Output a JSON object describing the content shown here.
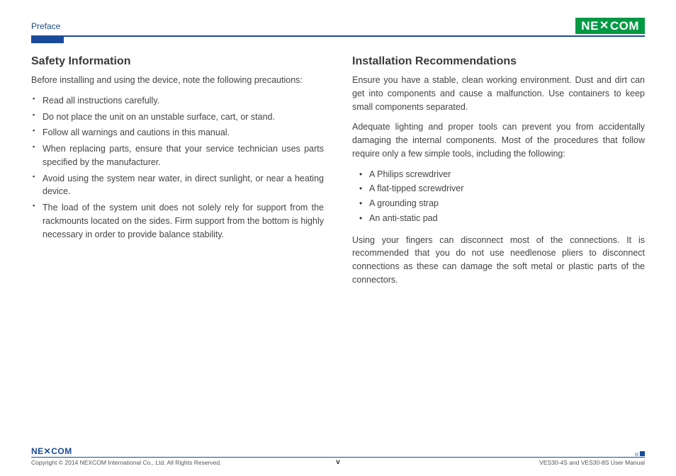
{
  "header": {
    "section": "Preface",
    "logo_text_left": "NE",
    "logo_text_right": "COM"
  },
  "left": {
    "heading": "Safety Information",
    "intro": "Before installing and using the device, note the following precautions:",
    "items": [
      "Read all instructions carefully.",
      "Do not place the unit on an unstable surface, cart, or stand.",
      "Follow all warnings and cautions in this manual.",
      "When replacing parts, ensure that your service technician uses parts specified by the manufacturer.",
      "Avoid using the system near water, in direct sunlight, or near a heating device.",
      "The load of the system unit does not solely rely for support from the rackmounts located on the sides. Firm support from the bottom is highly necessary in order to provide balance stability."
    ]
  },
  "right": {
    "heading": "Installation Recommendations",
    "para1": "Ensure you have a stable, clean working environment. Dust and dirt can get into components and cause a malfunction. Use containers to keep small components separated.",
    "para2": "Adequate lighting and proper tools can prevent you from accidentally damaging the internal components. Most of the procedures that follow require only a few simple tools, including the following:",
    "tools": [
      "A Philips screwdriver",
      "A flat-tipped screwdriver",
      "A grounding strap",
      "An anti-static pad"
    ],
    "para3": "Using your fingers can disconnect most of the connections. It is recommended that you do not use needlenose pliers to disconnect connections as these can damage the soft metal or plastic parts of the connectors."
  },
  "footer": {
    "logo_text_left": "NE",
    "logo_text_right": "COM",
    "copyright": "Copyright © 2014 NEXCOM International Co., Ltd. All Rights Reserved.",
    "page": "v",
    "doc_ref": "VES30-4S and VES30-8S User Manual"
  }
}
